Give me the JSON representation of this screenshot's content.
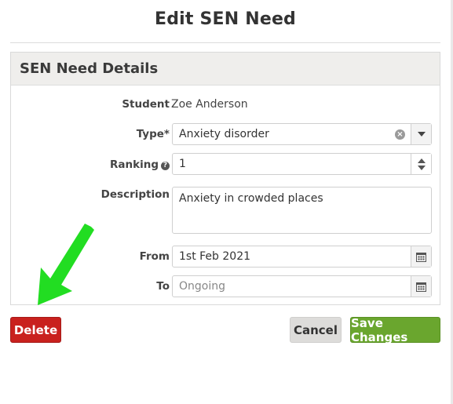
{
  "modal": {
    "title": "Edit SEN Need"
  },
  "panel": {
    "title": "SEN Need Details"
  },
  "form": {
    "student": {
      "label": "Student",
      "value": "Zoe Anderson"
    },
    "type": {
      "label": "Type*",
      "value": "Anxiety disorder"
    },
    "ranking": {
      "label": "Ranking",
      "value": "1"
    },
    "description": {
      "label": "Description",
      "value": "Anxiety in crowded places"
    },
    "from": {
      "label": "From",
      "value": "1st Feb 2021"
    },
    "to": {
      "label": "To",
      "placeholder": "Ongoing"
    }
  },
  "buttons": {
    "delete": "Delete",
    "cancel": "Cancel",
    "save": "Save Changes"
  },
  "colors": {
    "delete": "#c9211e",
    "save": "#6aa62e",
    "cancel": "#dddcda",
    "annotation_arrow": "#22dd22"
  },
  "icons": {
    "clear": "clear-icon",
    "dropdown": "caret-down-icon",
    "spinner": "spinner-arrows-icon",
    "calendar": "calendar-icon",
    "help": "question-circle-icon"
  }
}
